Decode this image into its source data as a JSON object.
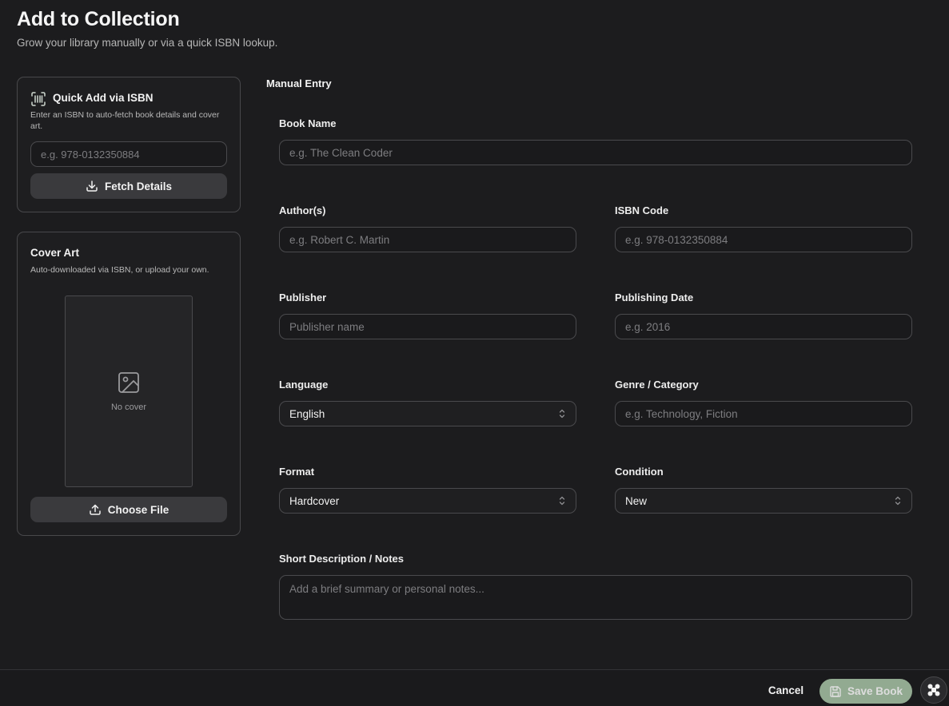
{
  "header": {
    "title": "Add to Collection",
    "subtitle": "Grow your library manually or via a quick ISBN lookup."
  },
  "isbn_card": {
    "icon": "barcode-icon",
    "title": "Quick Add via ISBN",
    "description": "Enter an ISBN to auto-fetch book details and cover art.",
    "input_placeholder": "e.g. 978-0132350884",
    "input_value": "",
    "button_label": "Fetch Details",
    "button_icon": "download-icon"
  },
  "cover_card": {
    "title": "Cover Art",
    "description": "Auto-downloaded via ISBN, or upload your own.",
    "placeholder_icon": "image-icon",
    "placeholder_text": "No cover",
    "button_label": "Choose File",
    "button_icon": "upload-icon"
  },
  "manual": {
    "section_label": "Manual Entry",
    "book_name": {
      "label": "Book Name",
      "placeholder": "e.g. The Clean Coder",
      "value": ""
    },
    "authors": {
      "label": "Author(s)",
      "placeholder": "e.g. Robert C. Martin",
      "value": ""
    },
    "isbn_code": {
      "label": "ISBN Code",
      "placeholder": "e.g. 978-0132350884",
      "value": ""
    },
    "publisher": {
      "label": "Publisher",
      "placeholder": "Publisher name",
      "value": ""
    },
    "publishing_date": {
      "label": "Publishing Date",
      "placeholder": "e.g. 2016",
      "value": ""
    },
    "language": {
      "label": "Language",
      "selected": "English"
    },
    "genre": {
      "label": "Genre / Category",
      "placeholder": "e.g. Technology, Fiction",
      "value": ""
    },
    "format": {
      "label": "Format",
      "selected": "Hardcover"
    },
    "condition": {
      "label": "Condition",
      "selected": "New"
    },
    "notes": {
      "label": "Short Description / Notes",
      "placeholder": "Add a brief summary or personal notes...",
      "value": ""
    }
  },
  "footer": {
    "cancel_label": "Cancel",
    "save_label": "Save Book",
    "save_icon": "floppy-disk-icon",
    "fab_icon": "app-grid-icon"
  },
  "colors": {
    "background": "#1c1c1e",
    "card_border": "#48484b",
    "accent_save": "#a8c4a6",
    "muted_text": "#b6b6b6"
  }
}
